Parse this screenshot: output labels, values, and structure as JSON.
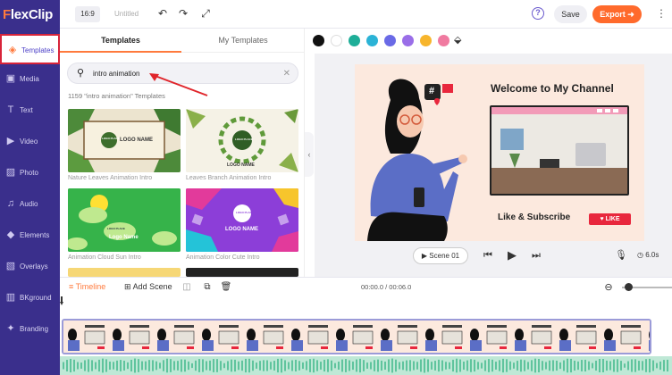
{
  "brand": {
    "logo_prefix": "F",
    "logo_rest": "lexClip",
    "accent": "#ff7a3d",
    "sidebar_bg": "#3a2f8c"
  },
  "sidebar": {
    "items": [
      {
        "label": "Templates",
        "icon": "layers-icon"
      },
      {
        "label": "Media",
        "icon": "media-icon"
      },
      {
        "label": "Text",
        "icon": "text-icon"
      },
      {
        "label": "Video",
        "icon": "video-icon"
      },
      {
        "label": "Photo",
        "icon": "photo-icon"
      },
      {
        "label": "Audio",
        "icon": "audio-icon"
      },
      {
        "label": "Elements",
        "icon": "elements-icon"
      },
      {
        "label": "Overlays",
        "icon": "overlays-icon"
      },
      {
        "label": "BKground",
        "icon": "background-icon"
      },
      {
        "label": "Branding",
        "icon": "branding-icon"
      }
    ]
  },
  "topbar": {
    "ratio": "16:9",
    "title": "Untitled",
    "save": "Save",
    "export": "Export",
    "help": "?"
  },
  "panel": {
    "tabs": [
      "Templates",
      "My Templates"
    ],
    "search_value": "intro animation",
    "count_text": "1159 \"intro animation\" Templates",
    "templates": [
      {
        "caption": "Nature Leaves Animation Intro",
        "logo_text": "LOGO NAME",
        "logo_place": "LOGO PLACE"
      },
      {
        "caption": "Leaves Branch Animation Intro",
        "logo_text": "LOGO NAME",
        "logo_place": "LOGO PLACE"
      },
      {
        "caption": "Animation Cloud Sun Intro",
        "logo_text": "Logo Name",
        "logo_place": "LOGO PLACE"
      },
      {
        "caption": "Animation Color Cute Intro",
        "logo_text": "LOGO NAME",
        "logo_place": "LOGO PLACE"
      }
    ]
  },
  "colors": [
    "#111111",
    "#ffffff",
    "#1eae98",
    "#2bb3d6",
    "#6a6ae6",
    "#9a6ee8",
    "#f7b52c",
    "#f07aa0"
  ],
  "canvas": {
    "welcome": "Welcome to My Channel",
    "like": "Like & Subscribe",
    "like_btn": "LIKE",
    "hashtag": "#"
  },
  "playback": {
    "scene": "Scene 01",
    "duration": "6.0s"
  },
  "timeline": {
    "label": "Timeline",
    "add_scene": "Add Scene",
    "timecode": "00:00.0 / 00:06.0",
    "thumb_title": "Welcome to My Channel"
  }
}
